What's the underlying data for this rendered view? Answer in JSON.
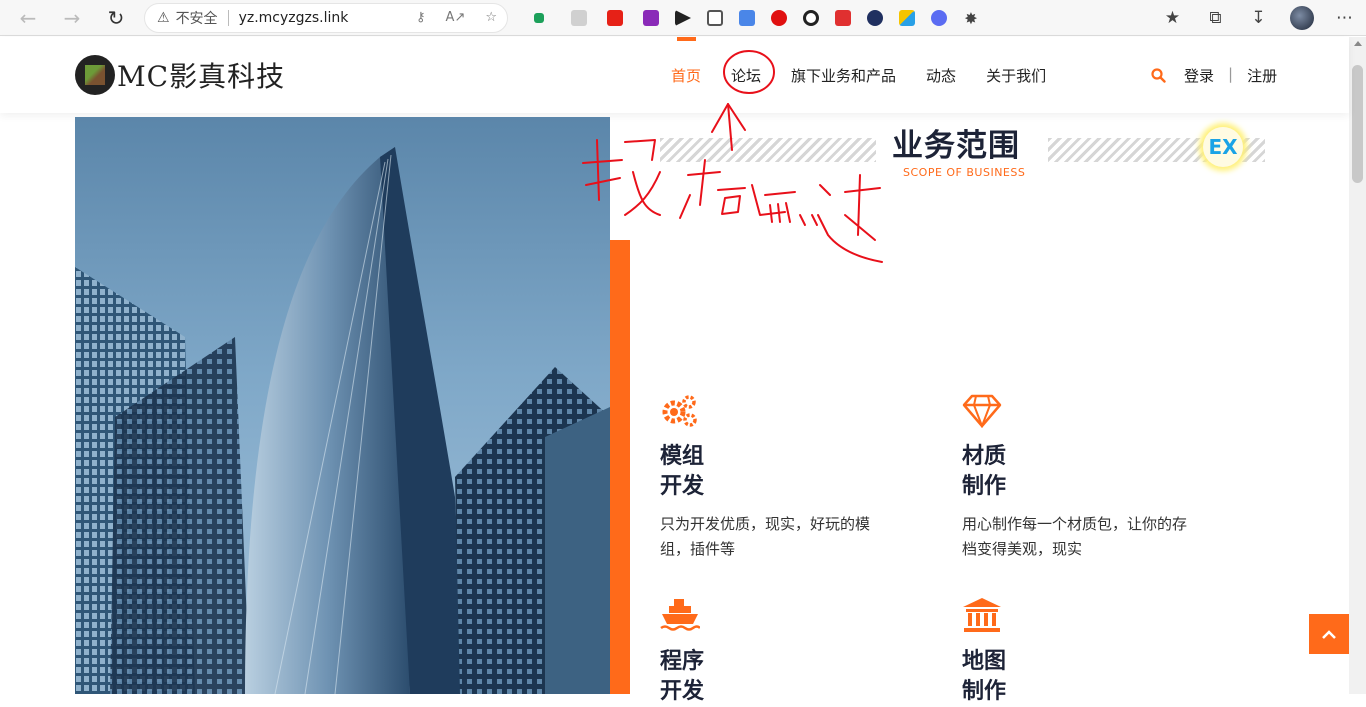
{
  "browser": {
    "insecure_label": "不安全",
    "url": "yz.mcyzgzs.link"
  },
  "site": {
    "logo_text": "MC影真科技",
    "menu": [
      {
        "label": "首页",
        "active": true
      },
      {
        "label": "论坛",
        "active": false
      },
      {
        "label": "旗下业务和产品",
        "active": false
      },
      {
        "label": "动态",
        "active": false
      },
      {
        "label": "关于我们",
        "active": false
      }
    ],
    "login": "登录",
    "separator": "|",
    "register": "注册",
    "accent_color": "#ff6a1a"
  },
  "section": {
    "title": "业务范围",
    "subtitle": "SCOPE OF BUSINESS",
    "badge": "EX"
  },
  "services": [
    {
      "icon": "gears-icon",
      "title_line1": "模组",
      "title_line2": "开发",
      "desc_line1": "只为开发优质，现实，好玩的模",
      "desc_line2": "组，插件等"
    },
    {
      "icon": "diamond-icon",
      "title_line1": "材质",
      "title_line2": "制作",
      "desc_line1": "用心制作每一个材质包，让你的存",
      "desc_line2": "档变得美观，现实"
    },
    {
      "icon": "ship-icon",
      "title_line1": "程序",
      "title_line2": "开发"
    },
    {
      "icon": "bank-icon",
      "title_line1": "地图",
      "title_line2": "制作"
    }
  ]
}
